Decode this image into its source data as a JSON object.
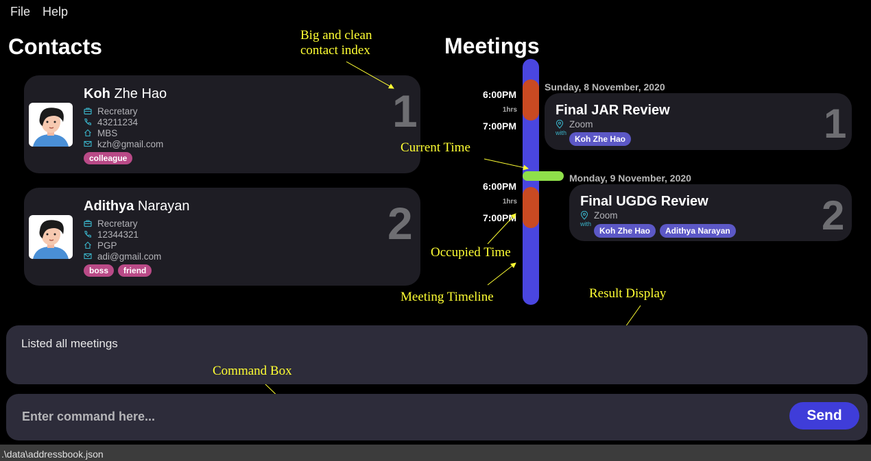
{
  "menu": {
    "file": "File",
    "help": "Help"
  },
  "contacts": {
    "title": "Contacts",
    "items": [
      {
        "first": "Koh",
        "last": "Zhe Hao",
        "role": "Recretary",
        "phone": "43211234",
        "address": "MBS",
        "email": "kzh@gmail.com",
        "tags": [
          "colleague"
        ],
        "index": "1"
      },
      {
        "first": "Adithya",
        "last": "Narayan",
        "role": "Recretary",
        "phone": "12344321",
        "address": "PGP",
        "email": "adi@gmail.com",
        "tags": [
          "boss",
          "friend"
        ],
        "index": "2"
      }
    ]
  },
  "meetings": {
    "title": "Meetings",
    "items": [
      {
        "start": "6:00PM",
        "duration": "1hrs",
        "end": "7:00PM",
        "date": "Sunday, 8 November, 2020",
        "title": "Final JAR Review",
        "location": "Zoom",
        "with": "with",
        "participants": [
          "Koh Zhe Hao"
        ],
        "index": "1"
      },
      {
        "start": "6:00PM",
        "duration": "1hrs",
        "end": "7:00PM",
        "date": "Monday, 9 November, 2020",
        "title": "Final UGDG Review",
        "location": "Zoom",
        "with": "with",
        "participants": [
          "Koh Zhe Hao",
          "Adithya Narayan"
        ],
        "index": "2"
      }
    ]
  },
  "annotations": {
    "index": "Big and clean\ncontact index",
    "current_time": "Current Time",
    "occupied_time": "Occupied Time",
    "meeting_timeline": "Meeting Timeline",
    "result_display": "Result Display",
    "command_box": "Command Box"
  },
  "result": {
    "text": "Listed all meetings"
  },
  "command": {
    "placeholder": "Enter command here...",
    "send_label": "Send"
  },
  "status": {
    "path": ".\\data\\addressbook.json"
  },
  "colors": {
    "timeline": "#4a46e0",
    "occupied": "#c94a22",
    "current_time": "#8fe04a",
    "tag": "#b94a87",
    "participant_tag": "#5c58c6",
    "annotation": "#ffff33",
    "send_button": "#3f3dd9"
  },
  "icons": [
    "briefcase-icon",
    "phone-icon",
    "home-icon",
    "mail-icon",
    "location-pin-icon"
  ]
}
